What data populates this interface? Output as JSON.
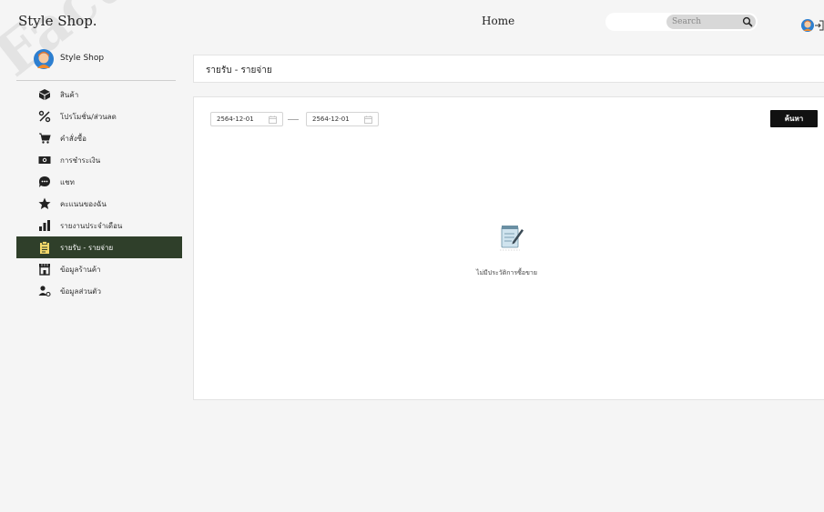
{
  "watermark": "Faculty of Infor",
  "header": {
    "brand": "Style Shop.",
    "page_title": "Home",
    "search_placeholder": "Search"
  },
  "sidebar": {
    "profile_name": "Style Shop",
    "items": [
      {
        "label": "สินค้า",
        "icon": "box-icon",
        "active": false
      },
      {
        "label": "โปรโมชั่น/ส่วนลด",
        "icon": "percent-icon",
        "active": false
      },
      {
        "label": "คำสั่งซื้อ",
        "icon": "cart-icon",
        "active": false
      },
      {
        "label": "การชำระเงิน",
        "icon": "money-icon",
        "active": false
      },
      {
        "label": "แชท",
        "icon": "chat-icon",
        "active": false
      },
      {
        "label": "คะแนนของฉัน",
        "icon": "star-icon",
        "active": false
      },
      {
        "label": "รายงานประจำเดือน",
        "icon": "bar-chart-icon",
        "active": false
      },
      {
        "label": "รายรับ - รายจ่าย",
        "icon": "clipboard-icon",
        "active": true
      },
      {
        "label": "ข้อมูลร้านค้า",
        "icon": "store-icon",
        "active": false
      },
      {
        "label": "ข้อมูลส่วนตัว",
        "icon": "user-settings-icon",
        "active": false
      }
    ]
  },
  "main": {
    "title": "รายรับ - รายจ่าย",
    "date_from": "2564-12-01",
    "date_to": "2564-12-01",
    "search_button": "ค้นหา",
    "empty_message": "ไม่มีประวัติการซื้อขาย"
  },
  "colors": {
    "active_menu_bg": "#2f3f2a",
    "button_bg": "#111111",
    "page_bg": "#f5f5f5"
  }
}
